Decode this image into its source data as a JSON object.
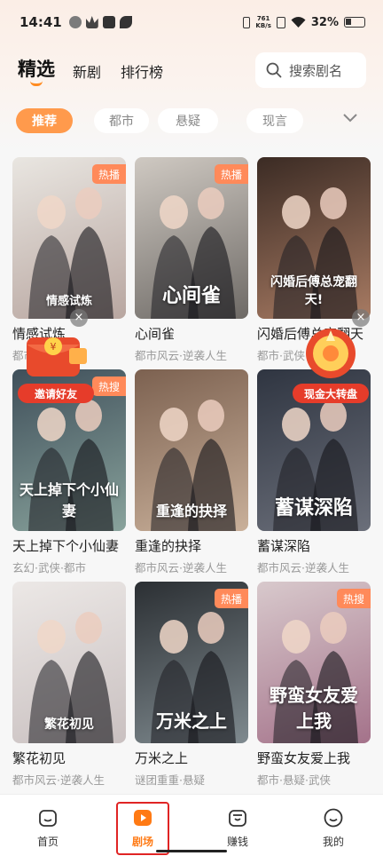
{
  "status_bar": {
    "time": "14:41",
    "net_speed_value": "761",
    "net_speed_unit": "KB/s",
    "battery": "32%"
  },
  "header": {
    "tabs": [
      {
        "label": "精选"
      },
      {
        "label": "新剧"
      },
      {
        "label": "排行榜"
      }
    ],
    "search": {
      "placeholder": "搜索剧名"
    }
  },
  "categories": [
    "推荐",
    "都市",
    "悬疑",
    "现言"
  ],
  "dramas": [
    {
      "title": "情感试炼",
      "meta": "都市·言情",
      "badge": "热播",
      "poster_text": "情感试炼",
      "colors": [
        "#e9e6e1",
        "#b8a6a0"
      ]
    },
    {
      "title": "心间雀",
      "meta": "都市风云·逆袭人生",
      "badge": "热播",
      "poster_text": "心间雀",
      "colors": [
        "#cfc9c2",
        "#6e6a66"
      ]
    },
    {
      "title": "闪婚后傅总宠翻天",
      "meta": "都市·武侠",
      "badge": "",
      "poster_text": "闪婚后傅总宠翻天!",
      "colors": [
        "#3b2b24",
        "#a87b63"
      ]
    },
    {
      "title": "天上掉下个小仙妻",
      "meta": "玄幻·武侠·都市",
      "badge": "热搜",
      "poster_text": "天上掉下个小仙妻",
      "colors": [
        "#3f4f5a",
        "#89a39c"
      ]
    },
    {
      "title": "重逢的抉择",
      "meta": "都市风云·逆袭人生",
      "badge": "",
      "poster_text": "重逢的抉择",
      "colors": [
        "#7c6150",
        "#c9b09a"
      ]
    },
    {
      "title": "蓄谋深陷",
      "meta": "都市风云·逆袭人生",
      "badge": "",
      "poster_text": "蓄谋深陷",
      "colors": [
        "#2f3541",
        "#6b6f7a"
      ]
    },
    {
      "title": "繁花初见",
      "meta": "都市风云·逆袭人生",
      "badge": "",
      "poster_text": "繁花初见",
      "colors": [
        "#ece8e6",
        "#c9c0c0"
      ]
    },
    {
      "title": "万米之上",
      "meta": "谜团重重·悬疑",
      "badge": "热播",
      "poster_text": "万米之上",
      "colors": [
        "#2b2f33",
        "#7f8a8f"
      ]
    },
    {
      "title": "野蛮女友爱上我",
      "meta": "都市·悬疑·武侠",
      "badge": "热搜",
      "poster_text": "野蛮女友爱上我",
      "colors": [
        "#d8c9cc",
        "#a4728a"
      ]
    }
  ],
  "floating": {
    "invite": {
      "label": "邀请好友"
    },
    "cash_wheel": {
      "label": "现金大转盘"
    }
  },
  "bottom_nav": [
    {
      "label": "首页",
      "icon": "home-icon"
    },
    {
      "label": "剧场",
      "icon": "theater-play-icon"
    },
    {
      "label": "赚钱",
      "icon": "wallet-icon"
    },
    {
      "label": "我的",
      "icon": "profile-icon"
    }
  ],
  "colors": {
    "accent": "#ff8a1f",
    "chip_active": "#ff9a4c",
    "badge": "#ff8a5a",
    "highlight_box": "#e02424"
  }
}
